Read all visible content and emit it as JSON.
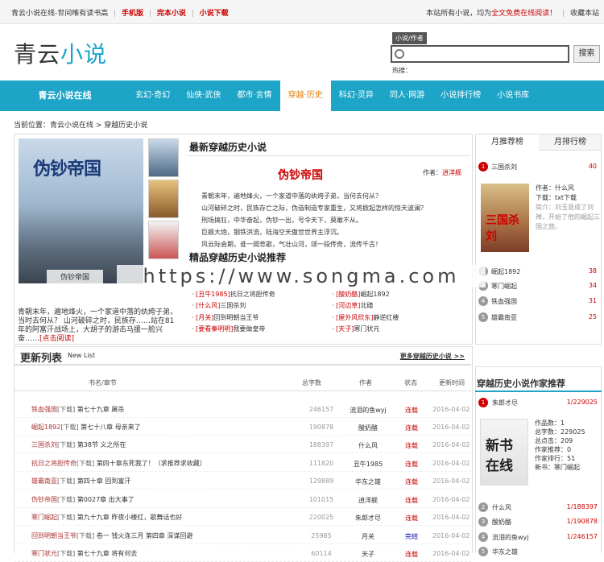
{
  "topbar": {
    "site_desc": "青云小说在线-世间唯有读书高",
    "links": [
      "手机版",
      "完本小说",
      "小说下载"
    ],
    "notice_pre": "本站所有小说，均为",
    "notice_red": "全文免费在线阅读",
    "notice_post": "！",
    "bookmark": "收藏本站"
  },
  "logo": {
    "a": "青云",
    "b": "小说"
  },
  "search": {
    "tag": "小说/作者",
    "button": "搜索",
    "hot_label": "热搜："
  },
  "nav": {
    "home": "青云小说在线",
    "items": [
      "玄幻·奇幻",
      "仙侠·武侠",
      "都市·言情",
      "穿越·历史",
      "科幻·灵异",
      "同人·网游",
      "小说排行榜",
      "小说书库"
    ]
  },
  "crumb": "当前位置：青云小说在线 > 穿越历史小说",
  "featured": {
    "cover_title": "伪钞帝国",
    "cover_caption": "伪钞帝国",
    "left_desc": "青朝末年，遍地烽火，一个家道中落的纨绔子弟，当时去何从？ 山河破碎之时，民族存……站在81年的阿富汗战场上，大胡子的游击马援一脸兴奋……",
    "left_more": "[点击阅读]",
    "section_title": "最新穿越历史小说",
    "book_title": "伪钞帝国",
    "author_label": "作者：",
    "author": "逍洋舰",
    "desc_lines": [
      "青朝末年，遍地烽火，一个家道中落的纨绔子弟，当何去何从？",
      "山河破碎之时，民族存亡之际，伪造制造专家重生，又将掀起怎样的惊天波澜？",
      "刑场搞狂，中华奋起，伪钞一出，号令天下，莫敢不从。",
      "巨舰大炮，钢铁洪流，陆海空天傲世世界主浮沉。",
      "风云际会期，谁一阕悲歌，气壮山河，颂一段传奇，流传千古！"
    ]
  },
  "recs": {
    "title": "精品穿越历史小说推荐",
    "left": [
      {
        "cat": "[丑牛1985]",
        "name": "抗日之将胆传奇"
      },
      {
        "cat": "[什么风]",
        "name": "三国杀刘"
      },
      {
        "cat": "[月关]",
        "name": "回到明朝当王爷"
      },
      {
        "cat": "[要看秦明明]",
        "name": "我要做皇帝"
      }
    ],
    "right": [
      {
        "cat": "[酸奶酪]",
        "name": "崛起1892"
      },
      {
        "cat": "[河边草]",
        "name": "北碴"
      },
      {
        "cat": "[屋外风欣东]",
        "name": "静逆红楼"
      },
      {
        "cat": "[天子]",
        "name": "寒门状元"
      }
    ]
  },
  "monthly": {
    "tabs": [
      "月推荐榜",
      "月排行榜"
    ],
    "first": {
      "name": "三国杀刘",
      "value": "40"
    },
    "info": [
      "作者：什么风",
      "下载：txt下载",
      "简介：刘玉意成了刘禅，开始了他的崛起三国之旅。"
    ],
    "rest": [
      {
        "rank": "2",
        "name": "崛起1892",
        "value": "38"
      },
      {
        "rank": "3",
        "name": "寒门崛起",
        "value": "34"
      },
      {
        "rank": "4",
        "name": "铁血强国",
        "value": "31"
      },
      {
        "rank": "5",
        "name": "雄霸南亚",
        "value": "25"
      }
    ]
  },
  "updates": {
    "title": "更新列表",
    "subtitle": "New List",
    "more": "更多穿越历史小说 >>",
    "headers": [
      "书名/章节",
      "总字数",
      "作者",
      "状态",
      "更新时间"
    ],
    "rows": [
      {
        "book": "铁血强国",
        "flag": "[下载]",
        "chapter": "第七十九章 屠杀",
        "words": "246157",
        "author": "流泪的鱼wyj",
        "status": "连载",
        "date": "2016-04-02"
      },
      {
        "book": "崛起1892",
        "flag": "[下载]",
        "chapter": "第七十八章 母亲来了",
        "words": "190878",
        "author": "酸奶酪",
        "status": "连载",
        "date": "2016-04-02"
      },
      {
        "book": "三国杀刘",
        "flag": "[下载]",
        "chapter": "第38节 义之所在",
        "words": "188397",
        "author": "什么风",
        "status": "连载",
        "date": "2016-04-02"
      },
      {
        "book": "抗日之将胆传奇",
        "flag": "[下载]",
        "chapter": "第四十章东死我了！（求推荐求收藏）",
        "words": "111820",
        "author": "丑牛1985",
        "status": "连载",
        "date": "2016-04-02"
      },
      {
        "book": "雄霸南亚",
        "flag": "[下载]",
        "chapter": "第四十章 回到富汗",
        "words": "129889",
        "author": "华东之雄",
        "status": "连载",
        "date": "2016-04-02"
      },
      {
        "book": "伪钞帝国",
        "flag": "[下载]",
        "chapter": "第0027章 出大事了",
        "words": "101015",
        "author": "逍洋舰",
        "status": "连载",
        "date": "2016-04-02"
      },
      {
        "book": "寒门崛起",
        "flag": "[下载]",
        "chapter": "第九十九章 昨夜小楼红，歌舞话也好",
        "words": "220025",
        "author": "朱郎才尽",
        "status": "连载",
        "date": "2016-04-02"
      },
      {
        "book": "回到明朝当王爷",
        "flag": "[下载]",
        "chapter": "卷一 钱火连三月 第四章 深谋回避",
        "words": "25985",
        "author": "月关",
        "status": "完结",
        "date": "2016-04-02"
      },
      {
        "book": "寒门状元",
        "flag": "[下载]",
        "chapter": "第七十九章 将有何去",
        "words": "60114",
        "author": "天子",
        "status": "连载",
        "date": "2016-04-02"
      }
    ]
  },
  "authors": {
    "title": "穿越历史小说作家推荐",
    "first": {
      "name": "朱郎才尽",
      "value": "1/229025"
    },
    "info": [
      "作品数：1",
      "总字数：229025",
      "总点击：209",
      "作家推荐：0",
      "作家排行：51",
      "新书：寒门崛起"
    ],
    "rest": [
      {
        "rank": "2",
        "name": "什么风",
        "value": "1/188397"
      },
      {
        "rank": "3",
        "name": "酸奶酪",
        "value": "1/190878"
      },
      {
        "rank": "4",
        "name": "流泪的鱼wyj",
        "value": "1/246157"
      },
      {
        "rank": "5",
        "name": "华东之雄",
        "value": ""
      }
    ]
  },
  "watermark": "https://www.songma.com"
}
